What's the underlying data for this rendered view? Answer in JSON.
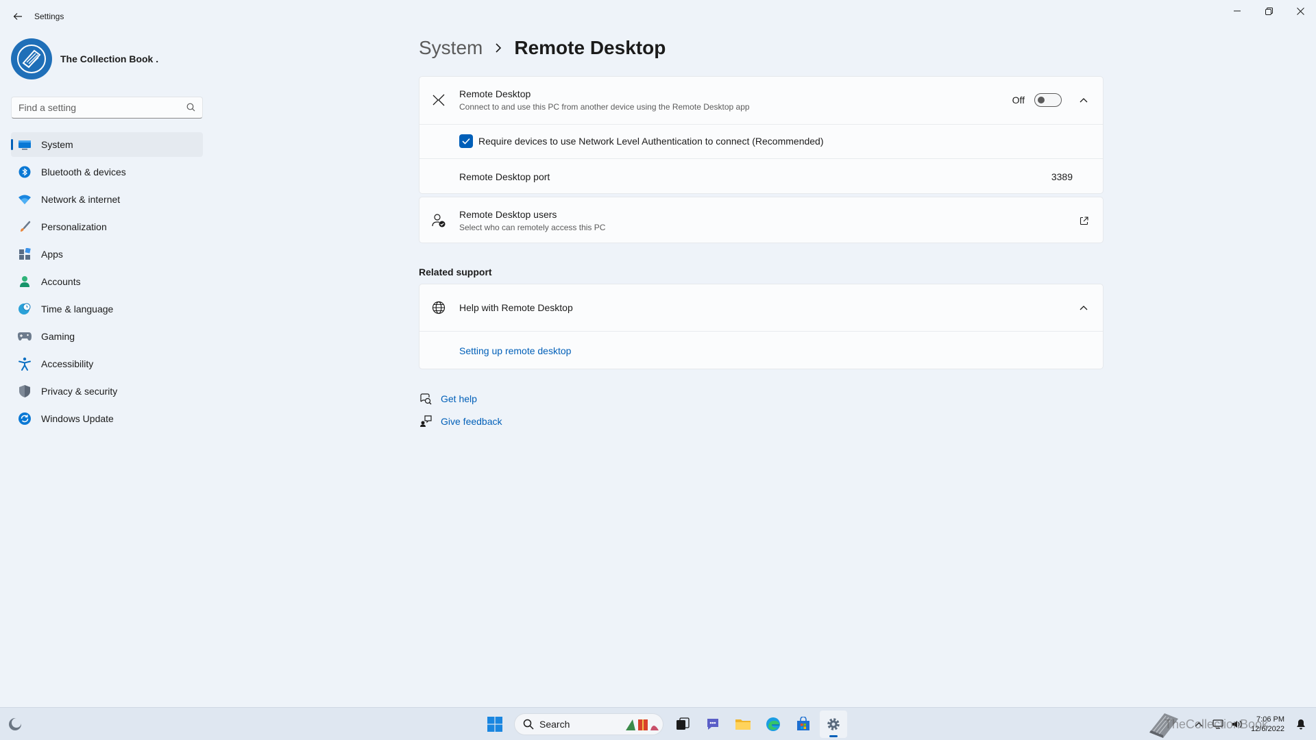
{
  "window": {
    "title": "Settings"
  },
  "profile": {
    "name": "The Collection Book ."
  },
  "search": {
    "placeholder": "Find a setting"
  },
  "sidebar": {
    "items": [
      {
        "label": "System",
        "icon": "system-icon",
        "active": true
      },
      {
        "label": "Bluetooth & devices",
        "icon": "bluetooth-icon"
      },
      {
        "label": "Network & internet",
        "icon": "wifi-icon"
      },
      {
        "label": "Personalization",
        "icon": "brush-icon"
      },
      {
        "label": "Apps",
        "icon": "apps-icon"
      },
      {
        "label": "Accounts",
        "icon": "person-icon"
      },
      {
        "label": "Time & language",
        "icon": "globe-clock-icon"
      },
      {
        "label": "Gaming",
        "icon": "gamepad-icon"
      },
      {
        "label": "Accessibility",
        "icon": "accessibility-icon"
      },
      {
        "label": "Privacy & security",
        "icon": "shield-icon"
      },
      {
        "label": "Windows Update",
        "icon": "update-icon"
      }
    ]
  },
  "breadcrumb": {
    "parent": "System",
    "current": "Remote Desktop"
  },
  "remote_desktop": {
    "title": "Remote Desktop",
    "description": "Connect to and use this PC from another device using the Remote Desktop app",
    "toggle_state": "Off",
    "nla_label": "Require devices to use Network Level Authentication to connect (Recommended)",
    "nla_checked": true,
    "port_label": "Remote Desktop port",
    "port_value": "3389"
  },
  "users": {
    "title": "Remote Desktop users",
    "description": "Select who can remotely access this PC"
  },
  "related_support": {
    "heading": "Related support",
    "help_title": "Help with Remote Desktop",
    "link": "Setting up remote desktop"
  },
  "help_links": {
    "get_help": "Get help",
    "give_feedback": "Give feedback"
  },
  "taskbar": {
    "search_label": "Search",
    "time": "7:06 PM",
    "date": "12/6/2022",
    "watermark": "TheCollectionBook"
  },
  "colors": {
    "accent": "#005fb8",
    "background": "#eef3f9",
    "card": "#fbfcfd"
  }
}
